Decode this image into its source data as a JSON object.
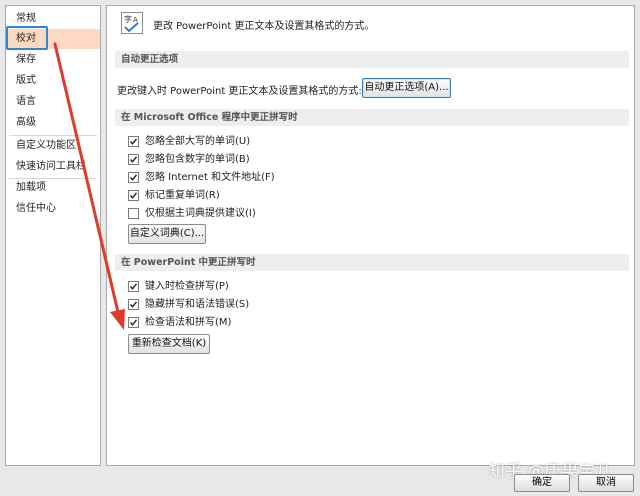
{
  "sidebar": {
    "items": [
      {
        "label": "常规"
      },
      {
        "label": "校对"
      },
      {
        "label": "保存"
      },
      {
        "label": "版式"
      },
      {
        "label": "语言"
      },
      {
        "label": "高级"
      },
      {
        "label": "自定义功能区"
      },
      {
        "label": "快速访问工具栏"
      },
      {
        "label": "加载项"
      },
      {
        "label": "信任中心"
      }
    ],
    "selected_index": 1
  },
  "header": {
    "icon": "abc-spelling-icon",
    "text": "更改 PowerPoint 更正文本及设置其格式的方式。"
  },
  "autocorrect": {
    "section_title": "自动更正选项",
    "description": "更改键入时 PowerPoint 更正文本及设置其格式的方式:",
    "button_label": "自动更正选项(A)..."
  },
  "office_spelling": {
    "section_title": "在 Microsoft Office 程序中更正拼写时",
    "options": [
      {
        "label": "忽略全部大写的单词(U)",
        "checked": true
      },
      {
        "label": "忽略包含数字的单词(B)",
        "checked": true
      },
      {
        "label": "忽略 Internet 和文件地址(F)",
        "checked": true
      },
      {
        "label": "标记重复单词(R)",
        "checked": true
      },
      {
        "label": "仅根据主词典提供建议(I)",
        "checked": false
      }
    ],
    "custom_dict_label": "自定义词典(C)..."
  },
  "ppt_spelling": {
    "section_title": "在 PowerPoint 中更正拼写时",
    "options": [
      {
        "label": "键入时检查拼写(P)",
        "checked": true
      },
      {
        "label": "隐藏拼写和语法错误(S)",
        "checked": true
      },
      {
        "label": "检查语法和拼写(M)",
        "checked": true
      }
    ],
    "recheck_label": "重新检查文档(K)"
  },
  "footer": {
    "ok_label": "确定",
    "cancel_label": "取消",
    "watermark": "知乎 @唐果宝儿"
  },
  "colors": {
    "selected_bg": "#fcd9c0",
    "highlight_border": "#2e86d6",
    "arrow": "#e03a2b"
  }
}
